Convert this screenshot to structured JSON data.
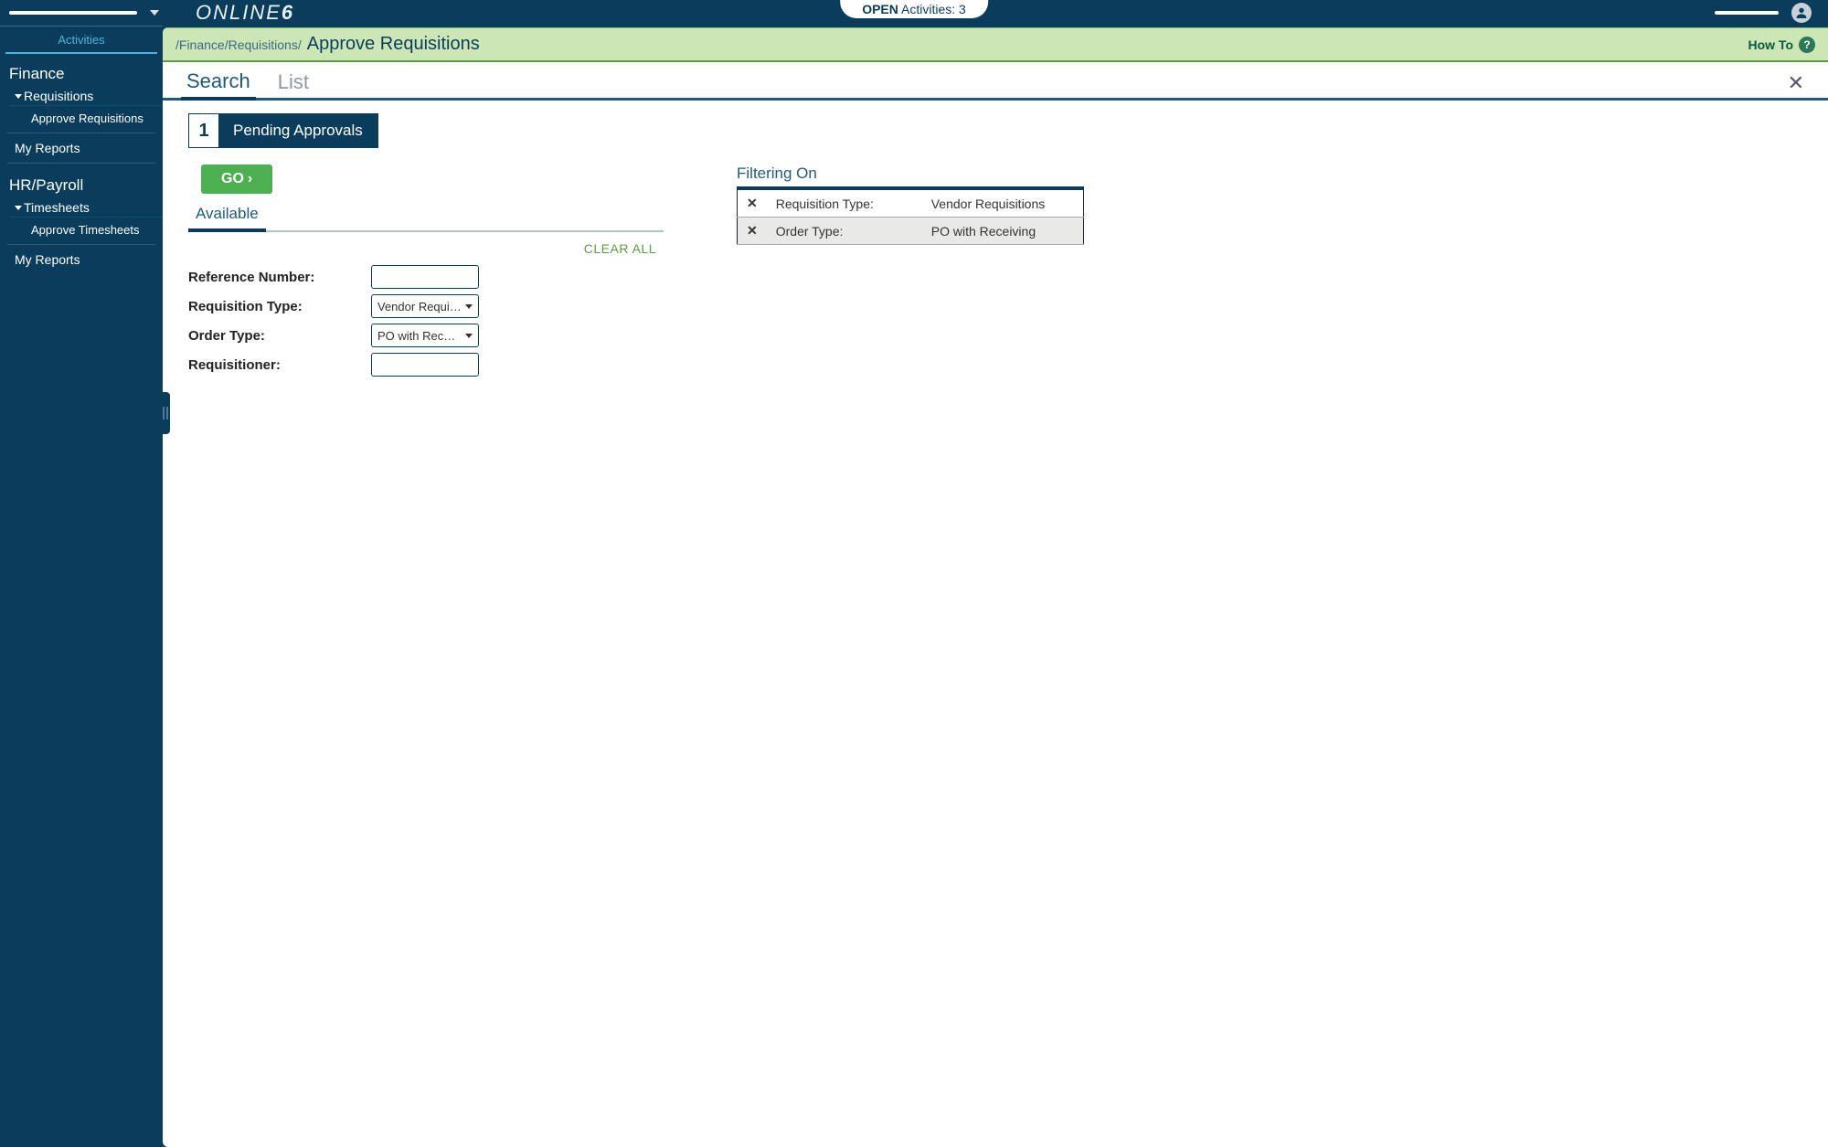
{
  "topbar": {
    "brand_text": "ONLINE",
    "brand_suffix": "6",
    "open_label": "OPEN",
    "activities_label": "Activities:",
    "activities_count": "3"
  },
  "sidebar": {
    "tab_label": "Activities",
    "sections": [
      {
        "title": "Finance",
        "group": "Requisitions",
        "items": [
          "Approve Requisitions"
        ],
        "extra": "My Reports"
      },
      {
        "title": "HR/Payroll",
        "group": "Timesheets",
        "items": [
          "Approve Timesheets"
        ],
        "extra": "My Reports"
      }
    ]
  },
  "breadcrumb": {
    "path": "/Finance/Requisitions/",
    "title": "Approve Requisitions",
    "howto_label": "How To"
  },
  "tabs": {
    "items": [
      "Search",
      "List"
    ],
    "active": 0
  },
  "step": {
    "number": "1",
    "label": "Pending Approvals"
  },
  "search": {
    "go_label": "GO",
    "subtabs": [
      "Available"
    ],
    "clear_all": "CLEAR ALL",
    "fields": {
      "reference_number": {
        "label": "Reference Number:",
        "value": ""
      },
      "requisition_type": {
        "label": "Requisition Type:",
        "value": "Vendor Requisiti…"
      },
      "order_type": {
        "label": "Order Type:",
        "value": "PO with Receivi…"
      },
      "requisitioner": {
        "label": "Requisitioner:",
        "value": ""
      }
    }
  },
  "filter": {
    "title": "Filtering On",
    "rows": [
      {
        "key": "Requisition Type:",
        "value": "Vendor Requisitions"
      },
      {
        "key": "Order Type:",
        "value": "PO with Receiving"
      }
    ]
  }
}
